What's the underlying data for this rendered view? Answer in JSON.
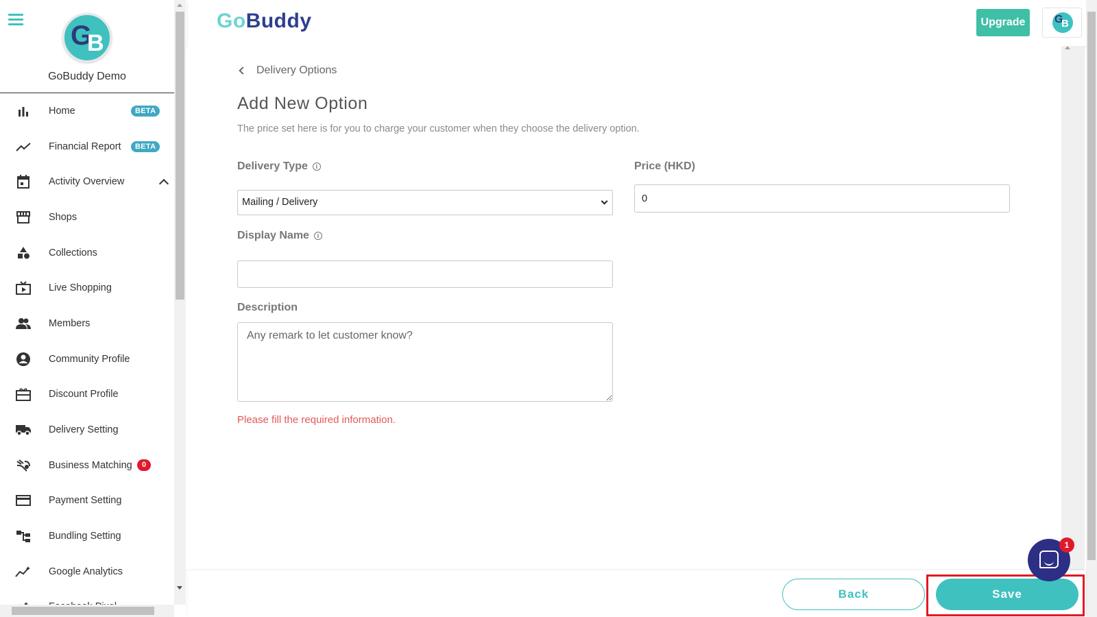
{
  "sidebar": {
    "org_name": "GoBuddy Demo",
    "avatar_initials": [
      "G",
      "B"
    ],
    "items": [
      {
        "label": "Home",
        "icon": "bar-chart-icon",
        "badge": "BETA"
      },
      {
        "label": "Financial Report",
        "icon": "trend-line-icon",
        "badge": "BETA"
      },
      {
        "label": "Activity Overview",
        "icon": "calendar-icon",
        "expanded": true
      },
      {
        "label": "Shops",
        "icon": "store-icon"
      },
      {
        "label": "Collections",
        "icon": "shapes-icon"
      },
      {
        "label": "Live Shopping",
        "icon": "live-tv-icon"
      },
      {
        "label": "Members",
        "icon": "people-icon"
      },
      {
        "label": "Community Profile",
        "icon": "account-circle-icon"
      },
      {
        "label": "Discount Profile",
        "icon": "gift-card-icon"
      },
      {
        "label": "Delivery Setting",
        "icon": "truck-icon"
      },
      {
        "label": "Business Matching",
        "icon": "handshake-icon",
        "count": "0"
      },
      {
        "label": "Payment Setting",
        "icon": "credit-card-icon"
      },
      {
        "label": "Bundling Setting",
        "icon": "account-tree-icon"
      },
      {
        "label": "Google Analytics",
        "icon": "analytics-icon"
      },
      {
        "label": "Facebook Pixel",
        "icon": "sparkle-icon"
      }
    ]
  },
  "header": {
    "brand_go": "Go",
    "brand_buddy": "Buddy",
    "upgrade_label": "Upgrade",
    "avatar_initials": [
      "G",
      "B"
    ]
  },
  "main": {
    "breadcrumb": "Delivery Options",
    "title": "Add New Option",
    "description": "The price set here is for you to charge your customer when they choose the delivery option.",
    "delivery_type": {
      "label": "Delivery Type",
      "value": "Mailing / Delivery"
    },
    "price": {
      "label": "Price (HKD)",
      "value": "0"
    },
    "display_name": {
      "label": "Display Name",
      "value": ""
    },
    "desc_field": {
      "label": "Description",
      "placeholder": "Any remark to let customer know?"
    },
    "error": "Please fill the required information."
  },
  "footer": {
    "back_label": "Back",
    "save_label": "Save"
  },
  "chat": {
    "badge": "1"
  },
  "colors": {
    "accent": "#3fc1c0",
    "brand_dark": "#2d3f8f",
    "upgrade": "#3fbfa6",
    "error": "#e45757",
    "highlight": "#e01a22"
  }
}
